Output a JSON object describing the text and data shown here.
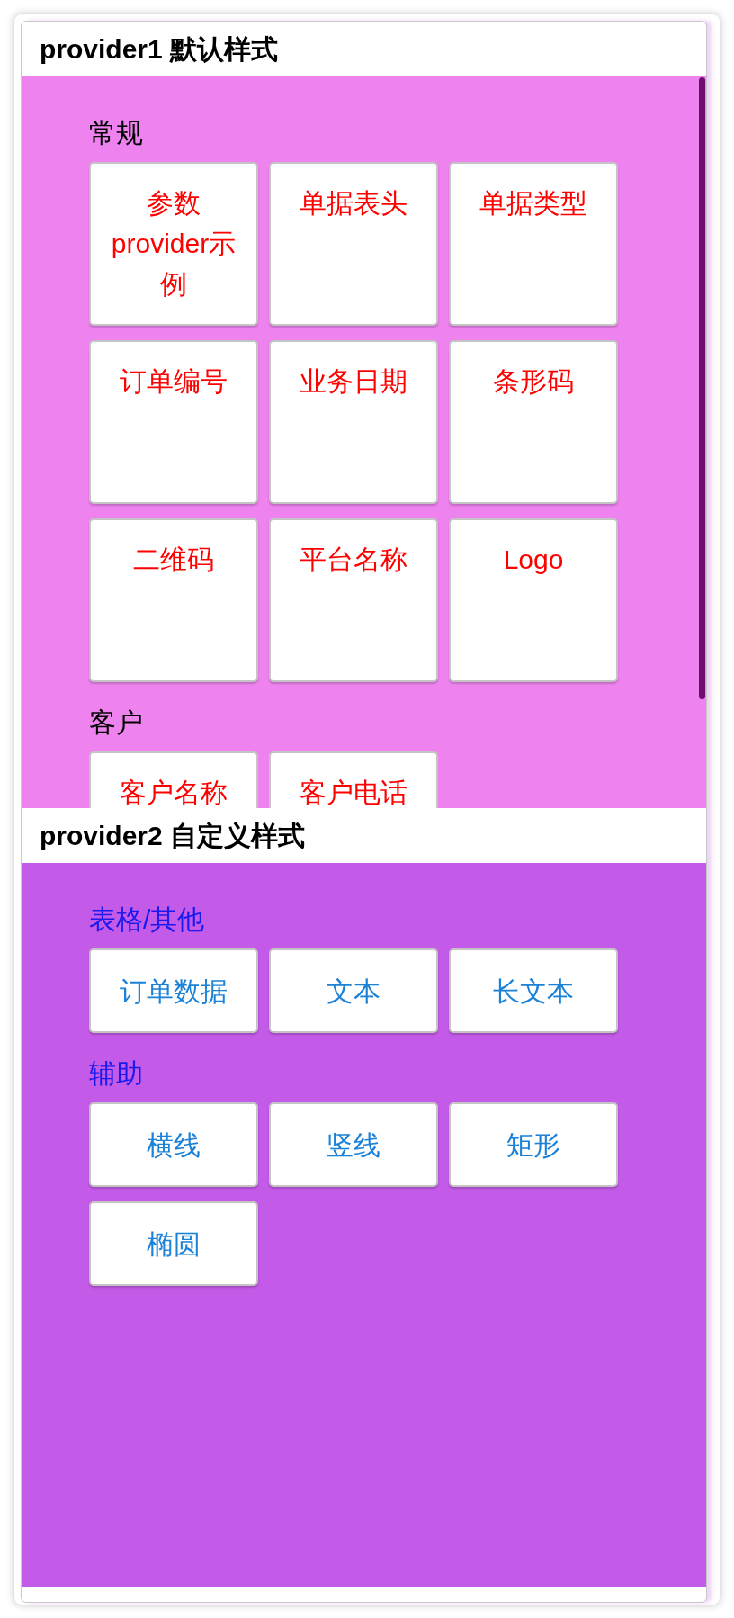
{
  "panels": [
    {
      "kind": "default",
      "title": "provider1 默认样式",
      "groups": [
        {
          "label": "常规",
          "items": [
            "参数provider示例",
            "单据表头",
            "单据类型",
            "订单编号",
            "业务日期",
            "条形码",
            "二维码",
            "平台名称",
            "Logo"
          ]
        },
        {
          "label": "客户",
          "items": [
            "客户名称",
            "客户电话"
          ]
        }
      ]
    },
    {
      "kind": "custom",
      "title": "provider2 自定义样式",
      "groups": [
        {
          "label": "表格/其他",
          "items": [
            "订单数据",
            "文本",
            "长文本"
          ]
        },
        {
          "label": "辅助",
          "items": [
            "横线",
            "竖线",
            "矩形",
            "椭圆"
          ]
        }
      ]
    }
  ]
}
